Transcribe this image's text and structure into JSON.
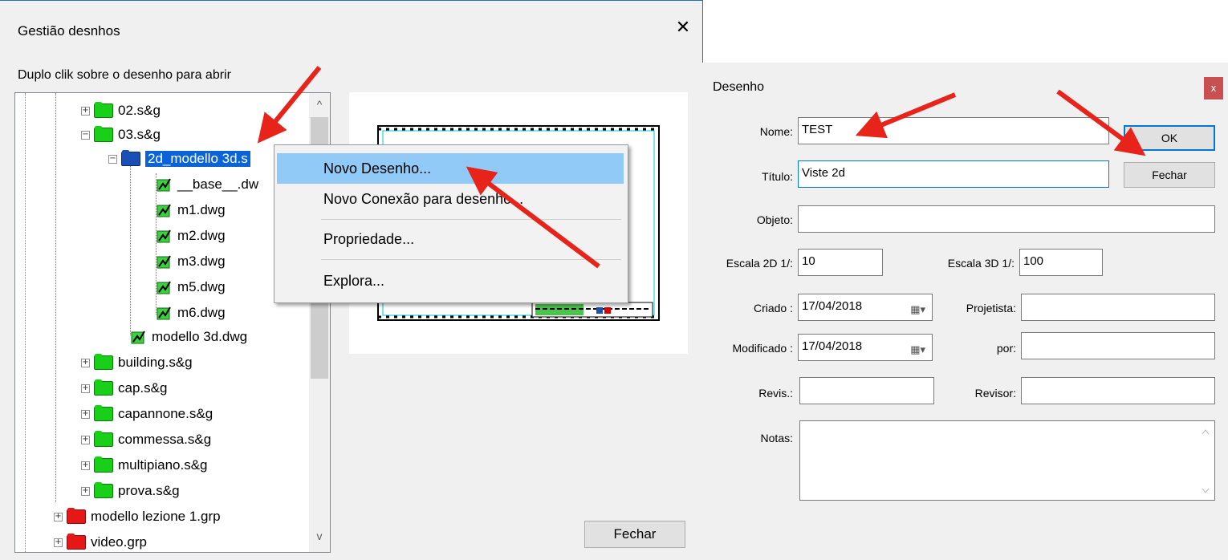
{
  "left_dialog": {
    "title": "Gestião desnhos",
    "close_label": "✕",
    "instruction": "Duplo clik sobre o desenho para abrir",
    "close_button_label": "Fechar"
  },
  "tree": {
    "items": [
      {
        "label": "02.s&g",
        "icon": "green-folder-icon",
        "expander": "+"
      },
      {
        "label": "03.s&g",
        "icon": "green-folder-icon",
        "expander": "−"
      },
      {
        "label": "2d_modello 3d.s",
        "icon": "blue-folder-icon",
        "expander": "−",
        "selected": true
      },
      {
        "label": "__base__.dw",
        "icon": "dwg-file-icon"
      },
      {
        "label": "m1.dwg",
        "icon": "dwg-file-icon"
      },
      {
        "label": "m2.dwg",
        "icon": "dwg-file-icon"
      },
      {
        "label": "m3.dwg",
        "icon": "dwg-file-icon"
      },
      {
        "label": "m5.dwg",
        "icon": "dwg-file-icon"
      },
      {
        "label": "m6.dwg",
        "icon": "dwg-file-icon"
      },
      {
        "label": "modello 3d.dwg",
        "icon": "dwg-file-icon"
      },
      {
        "label": "building.s&g",
        "icon": "green-folder-icon",
        "expander": "+"
      },
      {
        "label": "cap.s&g",
        "icon": "green-folder-icon",
        "expander": "+"
      },
      {
        "label": "capannone.s&g",
        "icon": "green-folder-icon",
        "expander": "+"
      },
      {
        "label": "commessa.s&g",
        "icon": "green-folder-icon",
        "expander": "+"
      },
      {
        "label": "multipiano.s&g",
        "icon": "green-folder-icon",
        "expander": "+"
      },
      {
        "label": "prova.s&g",
        "icon": "green-folder-icon",
        "expander": "+"
      },
      {
        "label": "modello lezione 1.grp",
        "icon": "red-folder-icon",
        "expander": "+"
      },
      {
        "label": "video.grp",
        "icon": "red-folder-icon",
        "expander": "+"
      }
    ],
    "scroll_up": "^",
    "scroll_down": "v"
  },
  "context_menu": {
    "items": [
      "Novo Desenho...",
      "Novo Conexão para desenho...",
      "Propriedade...",
      "Explora..."
    ]
  },
  "right_dialog": {
    "title": "Desenho",
    "close_label": "x",
    "nome_label": "Nome:",
    "nome_value": "TEST",
    "titulo_label": "Título:",
    "titulo_value": "Viste 2d",
    "objeto_label": "Objeto:",
    "objeto_value": "",
    "escala2d_label": "Escala 2D 1/:",
    "escala2d_value": "10",
    "escala3d_label": "Escala 3D 1/:",
    "escala3d_value": "100",
    "criado_label": "Criado :",
    "criado_value": "17/04/2018",
    "projetista_label": "Projetista:",
    "projetista_value": "",
    "modificado_label": "Modificado :",
    "modificado_value": "17/04/2018",
    "por_label": "por:",
    "por_value": "",
    "revis_label": "Revis.:",
    "revis_value": "",
    "revisor_label": "Revisor:",
    "revisor_value": "",
    "notas_label": "Notas:",
    "notas_value": "",
    "ok_label": "OK",
    "fechar_label": "Fechar",
    "calendar_glyph": "▦▾"
  },
  "colors": {
    "annotation_arrow": "#e8231a",
    "selection": "#0a64d8",
    "menu_highlight": "#91c9f7",
    "close_red": "#c75050"
  }
}
